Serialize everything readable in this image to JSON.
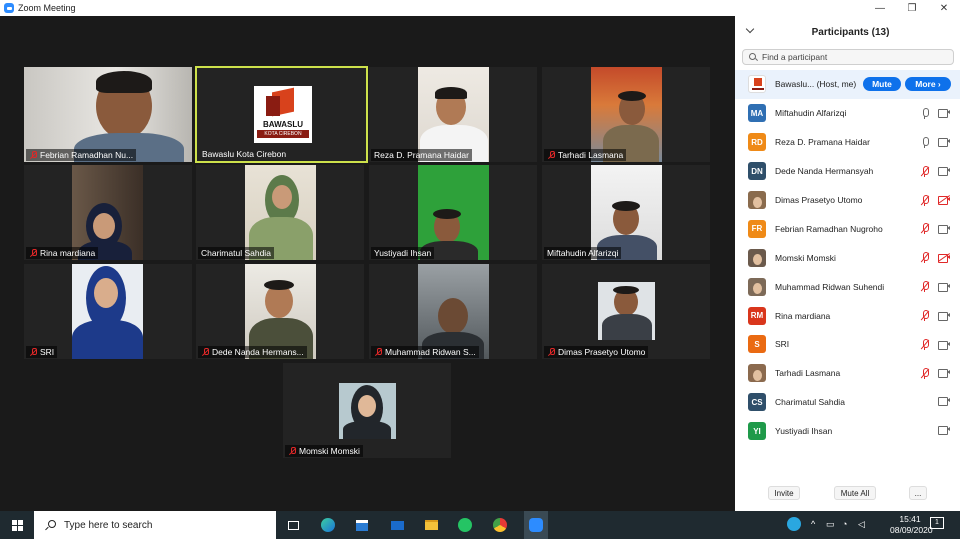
{
  "window": {
    "title": "Zoom Meeting",
    "minimize": "—",
    "maximize": "❐",
    "close": "✕"
  },
  "tiles": [
    {
      "name": "Febrian Ramadhan Nu...",
      "muted": true
    },
    {
      "name": "Bawaslu Kota Cirebon",
      "muted": false,
      "logo_text": "BAWASLU",
      "logo_sub": "KOTA CIREBON"
    },
    {
      "name": "Reza D. Pramana Haidar",
      "muted": false
    },
    {
      "name": "Tarhadi Lasmana",
      "muted": true
    },
    {
      "name": "Rina mardiana",
      "muted": true
    },
    {
      "name": "Charimatul Sahdia",
      "muted": false
    },
    {
      "name": "Yustiyadi Ihsan",
      "muted": false
    },
    {
      "name": "Miftahudin Alfarizqi",
      "muted": false
    },
    {
      "name": "SRI",
      "muted": true
    },
    {
      "name": "Dede Nanda Hermans...",
      "muted": true
    },
    {
      "name": "Muhammad Ridwan S...",
      "muted": true
    },
    {
      "name": "Dimas Prasetyo Utomo",
      "muted": true
    },
    {
      "name": "Momski Momski",
      "muted": true
    }
  ],
  "panel": {
    "title": "Participants (13)",
    "search_placeholder": "Find a participant",
    "host_row": {
      "name": "Bawaslu... (Host, me)",
      "mute_label": "Mute",
      "more_label": "More ›"
    },
    "participants": [
      {
        "initials": "MA",
        "name": "Miftahudin Alfarizqi",
        "color": "#2f6fb3",
        "mic": "on",
        "cam": "on"
      },
      {
        "initials": "RD",
        "name": "Reza D. Pramana Haidar",
        "color": "#ef8a17",
        "mic": "on",
        "cam": "on"
      },
      {
        "initials": "DN",
        "name": "Dede Nanda Hermansyah",
        "color": "#2f4f6a",
        "mic": "off",
        "cam": "on"
      },
      {
        "initials": "",
        "name": "Dimas Prasetyo Utomo",
        "color": "#8a6b4d",
        "mic": "off",
        "cam": "off"
      },
      {
        "initials": "FR",
        "name": "Febrian Ramadhan Nugroho",
        "color": "#ef8a17",
        "mic": "off",
        "cam": "on"
      },
      {
        "initials": "",
        "name": "Momski Momski",
        "color": "#6b5a4c",
        "mic": "off",
        "cam": "off"
      },
      {
        "initials": "",
        "name": "Muhammad Ridwan Suhendi",
        "color": "#7d6a58",
        "mic": "off",
        "cam": "on"
      },
      {
        "initials": "RM",
        "name": "Rina mardiana",
        "color": "#d9361c",
        "mic": "off",
        "cam": "on"
      },
      {
        "initials": "S",
        "name": "SRI",
        "color": "#ea6a12",
        "mic": "off",
        "cam": "on"
      },
      {
        "initials": "",
        "name": "Tarhadi Lasmana",
        "color": "#8b6a4e",
        "mic": "off",
        "cam": "on"
      },
      {
        "initials": "CS",
        "name": "Charimatul Sahdia",
        "color": "#2f4f6a",
        "mic": "none",
        "cam": "on"
      },
      {
        "initials": "YI",
        "name": "Yustiyadi Ihsan",
        "color": "#1f9a4a",
        "mic": "none",
        "cam": "on"
      }
    ],
    "footer": {
      "invite": "Invite",
      "mute_all": "Mute All",
      "more": "..."
    }
  },
  "taskbar": {
    "search_placeholder": "Type here to search",
    "time": "15:41",
    "date": "08/09/2020",
    "notification_count": "1"
  },
  "colors": {
    "accent": "#0e71eb",
    "active_speaker": "#cde14b",
    "muted_red": "#e02828"
  }
}
